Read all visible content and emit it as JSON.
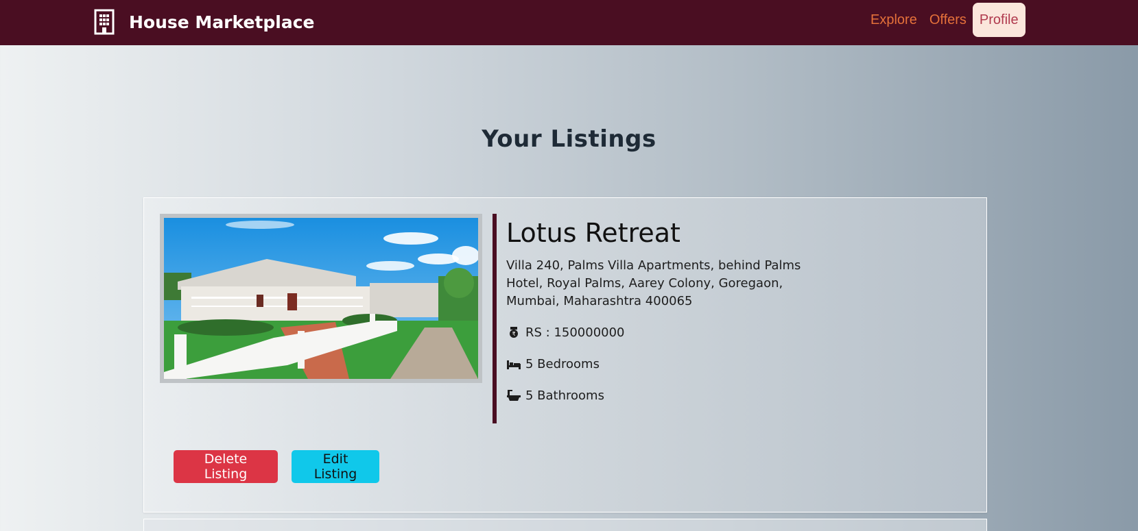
{
  "navbar": {
    "brand": "House Marketplace",
    "brand_icon": "building-icon",
    "links": [
      {
        "label": "Explore",
        "active": false
      },
      {
        "label": "Offers",
        "active": false
      },
      {
        "label": "Profile",
        "active": true
      }
    ],
    "colors": {
      "background": "#4a0e22",
      "link": "#e5713a",
      "active_bg": "#fbe6dc",
      "active_text": "#b03a4e"
    }
  },
  "page": {
    "title": "Your Listings"
  },
  "listings": [
    {
      "name": "Lotus Retreat",
      "address": "Villa 240, Palms Villa Apartments, behind Palms Hotel, Royal Palms, Aarey Colony, Goregaon, Mumbai, Maharashtra 400065",
      "price": "RS : 150000000",
      "price_icon": "rupee-coin-icon",
      "bedrooms": "5 Bedrooms",
      "bedrooms_icon": "bed-icon",
      "bathrooms": "5 Bathrooms",
      "bathrooms_icon": "bathtub-icon",
      "image": "house-photo",
      "actions": {
        "delete_label": "Delete Listing",
        "edit_label": "Edit Listing"
      }
    }
  ],
  "colors": {
    "delete": "#dc3545",
    "edit": "#10c8ea",
    "accent": "#4a0e22"
  }
}
